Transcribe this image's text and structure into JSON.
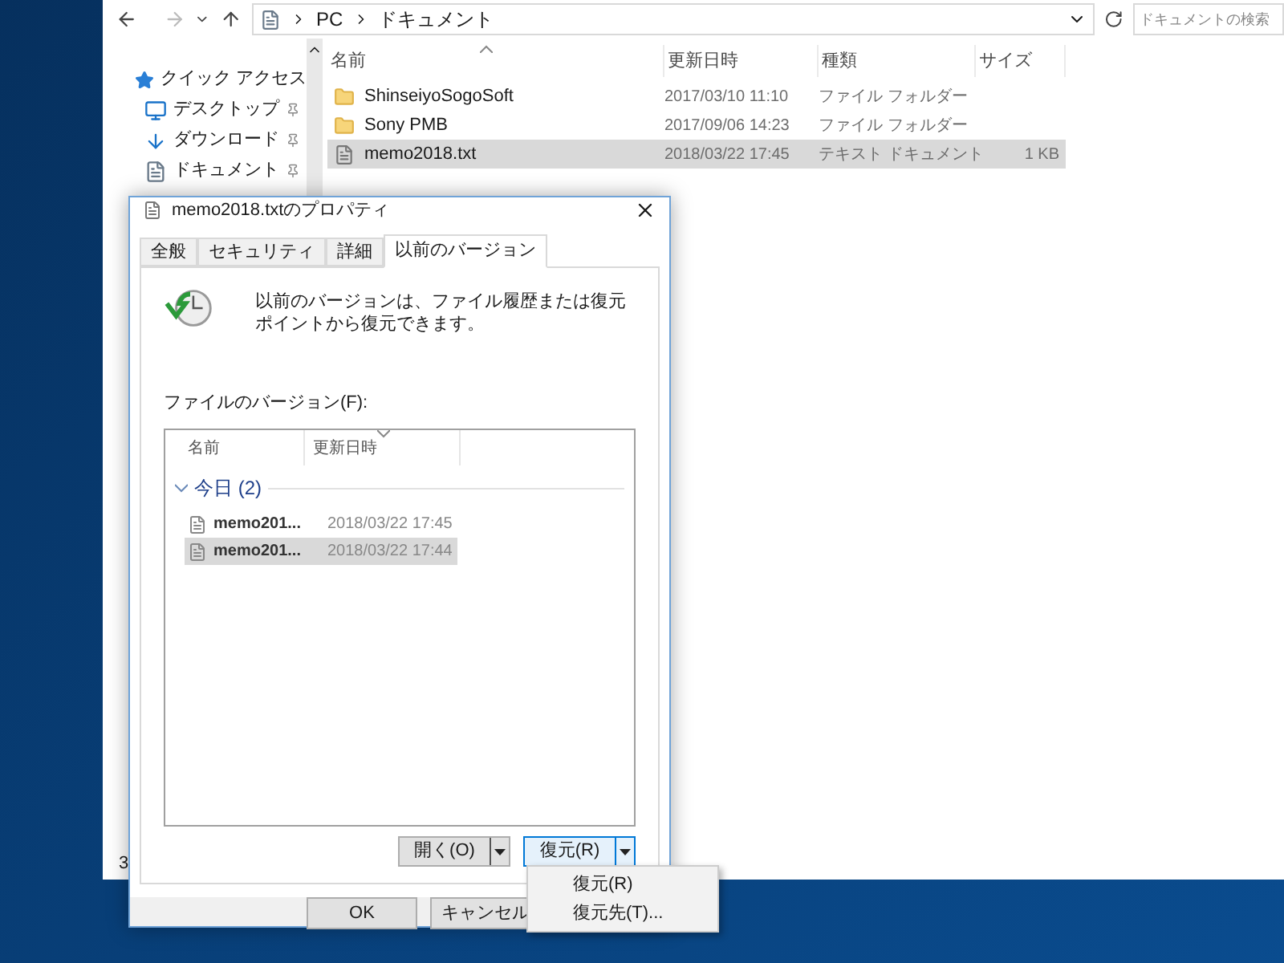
{
  "explorer": {
    "address": [
      "PC",
      "ドキュメント"
    ],
    "search": {
      "placeholder": "ドキュメントの検索"
    },
    "nav": [
      {
        "label": "クイック アクセス",
        "pinned": false
      },
      {
        "label": "デスクトップ",
        "pinned": true
      },
      {
        "label": "ダウンロード",
        "pinned": true
      },
      {
        "label": "ドキュメント",
        "pinned": true
      }
    ],
    "columns": [
      "名前",
      "更新日時",
      "種類",
      "サイズ"
    ],
    "rows": [
      {
        "kind": "folder",
        "name": "ShinseiyoSogoSoft",
        "date": "2017/03/10 11:10",
        "type": "ファイル フォルダー",
        "size": null,
        "selected": false
      },
      {
        "kind": "folder",
        "name": "Sony PMB",
        "date": "2017/09/06 14:23",
        "type": "ファイル フォルダー",
        "size": null,
        "selected": false
      },
      {
        "kind": "file",
        "name": "memo2018.txt",
        "date": "2018/03/22 17:45",
        "type": "テキスト ドキュメント",
        "size": "1 KB",
        "selected": true
      }
    ],
    "status_bar": "3"
  },
  "dialog": {
    "title": "memo2018.txtのプロパティ",
    "tabs": [
      {
        "label": "全般",
        "selected": false
      },
      {
        "label": "セキュリティ",
        "selected": false
      },
      {
        "label": "詳細",
        "selected": false
      },
      {
        "label": "以前のバージョン",
        "selected": true
      }
    ],
    "description": "以前のバージョンは、ファイル履歴または復元ポイントから復元できます。",
    "list_label": "ファイルのバージョン(F):",
    "columns": [
      "名前",
      "更新日時"
    ],
    "group": {
      "label": "今日 (2)",
      "expanded": true
    },
    "versions": [
      {
        "name": "memo201...",
        "date": "2018/03/22 17:45",
        "selected": false
      },
      {
        "name": "memo201...",
        "date": "2018/03/22 17:44",
        "selected": true
      }
    ],
    "open_button": "開く(O)",
    "restore_button": "復元(R)",
    "buttons": [
      "OK",
      "キャンセル"
    ]
  },
  "menu": [
    "復元(R)",
    "復元先(T)..."
  ]
}
